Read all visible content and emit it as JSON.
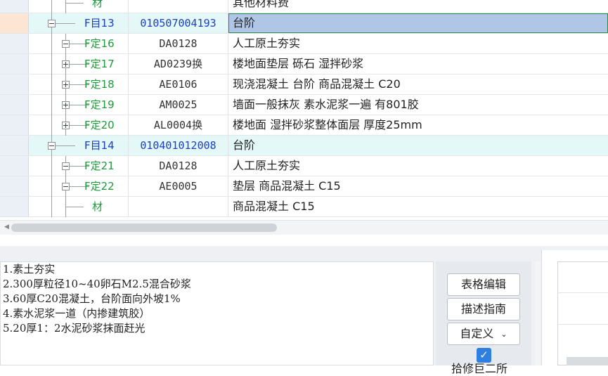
{
  "colors": {
    "accent_green": "#1f9a3a",
    "code_blue": "#1a3fc4",
    "selected_cell_bg": "#afc6e6",
    "highlight_row_bg": "#e4f8f8",
    "checkbox_blue": "#2f7fe0"
  },
  "grid": {
    "rows": [
      {
        "label": "材",
        "code": "",
        "name": "其他材料费",
        "type": "material",
        "expander": "none"
      },
      {
        "label": "F目13",
        "code": "010507004193",
        "name": "台阶",
        "type": "item",
        "expander": "minus",
        "selected": true
      },
      {
        "label": "F定16",
        "code": "DA0128",
        "name": "人工原土夯实",
        "type": "quota",
        "expander": "minus"
      },
      {
        "label": "F定17",
        "code": "AD0239换",
        "name": "楼地面垫层 砾石 湿拌砂浆",
        "type": "quota",
        "expander": "plus"
      },
      {
        "label": "F定18",
        "code": "AE0106",
        "name": "现浇混凝土 台阶 商品混凝土 C20",
        "type": "quota",
        "expander": "plus"
      },
      {
        "label": "F定19",
        "code": "AM0025",
        "name": "墙面一般抹灰 素水泥浆一遍 有801胶",
        "type": "quota",
        "expander": "plus"
      },
      {
        "label": "F定20",
        "code": "AL0004换",
        "name": "楼地面 湿拌砂浆整体面层 厚度25mm",
        "type": "quota",
        "expander": "plus"
      },
      {
        "label": "F目14",
        "code": "010401012008",
        "name": "台阶",
        "type": "item",
        "expander": "minus"
      },
      {
        "label": "F定21",
        "code": "DA0128",
        "name": "人工原土夯实",
        "type": "quota",
        "expander": "minus"
      },
      {
        "label": "F定22",
        "code": "AE0005",
        "name": "垫层 商品混凝土 C15",
        "type": "quota",
        "expander": "minus"
      },
      {
        "label": "材",
        "code": "",
        "name": "商品混凝土 C15",
        "type": "material",
        "expander": "none"
      }
    ]
  },
  "description": {
    "lines": [
      "1.素土夯实",
      "2.300厚粒径10~40卵石M2.5混合砂浆",
      "3.60厚C20混凝土，台阶面向外坡1%",
      "4.素水泥浆一道（内掺建筑胶）",
      "5.20厚1：2水泥砂浆抹面赶光"
    ]
  },
  "buttons": {
    "table_edit": "表格编辑",
    "desc_guide": "描述指南",
    "custom": "自定义",
    "cut_label": "拾修巨二所",
    "check_mark": "✓",
    "chevron": "⌄"
  },
  "scrollbar": {
    "left_arrow": "◀"
  }
}
